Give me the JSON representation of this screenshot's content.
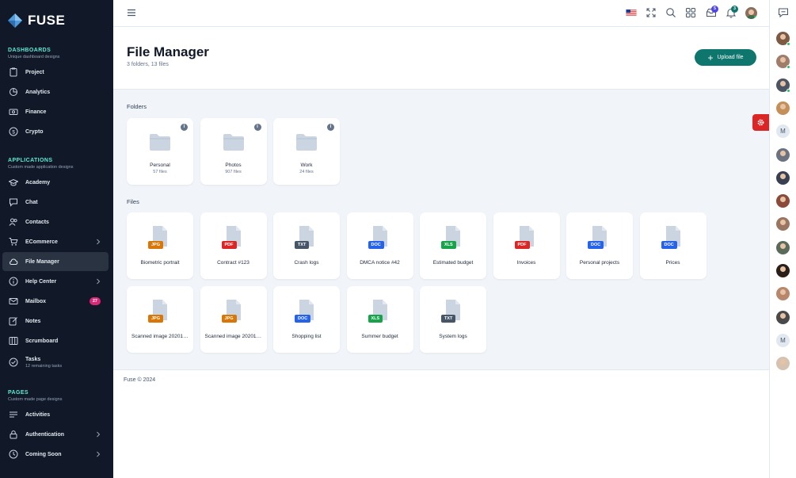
{
  "brand": {
    "name": "FUSE"
  },
  "sidebar": {
    "groups": [
      {
        "title": "DASHBOARDS",
        "subtitle": "Unique dashboard designs",
        "items": [
          {
            "label": "Project"
          },
          {
            "label": "Analytics"
          },
          {
            "label": "Finance"
          },
          {
            "label": "Crypto"
          }
        ]
      },
      {
        "title": "APPLICATIONS",
        "subtitle": "Custom made application designs",
        "items": [
          {
            "label": "Academy"
          },
          {
            "label": "Chat"
          },
          {
            "label": "Contacts"
          },
          {
            "label": "ECommerce"
          },
          {
            "label": "File Manager"
          },
          {
            "label": "Help Center"
          },
          {
            "label": "Mailbox",
            "badge": "27"
          },
          {
            "label": "Notes"
          },
          {
            "label": "Scrumboard"
          },
          {
            "label": "Tasks",
            "sub": "12 remaining tasks"
          }
        ]
      },
      {
        "title": "PAGES",
        "subtitle": "Custom made page designs",
        "items": [
          {
            "label": "Activities"
          },
          {
            "label": "Authentication"
          },
          {
            "label": "Coming Soon"
          }
        ]
      }
    ]
  },
  "topbar": {
    "messages_badge": "5",
    "notifications_badge": "3"
  },
  "header": {
    "title": "File Manager",
    "meta": "3 folders, 13 files",
    "upload_label": "Upload file"
  },
  "sections": {
    "folders": "Folders",
    "files": "Files"
  },
  "folders": [
    {
      "name": "Personal",
      "count": "57 files"
    },
    {
      "name": "Photos",
      "count": "907 files"
    },
    {
      "name": "Work",
      "count": "24 files"
    }
  ],
  "files": [
    {
      "name": "Biometric portrait",
      "type": "JPG"
    },
    {
      "name": "Contract #123",
      "type": "PDF"
    },
    {
      "name": "Crash logs",
      "type": "TXT"
    },
    {
      "name": "DMCA notice #42",
      "type": "DOC"
    },
    {
      "name": "Estimated budget",
      "type": "XLS"
    },
    {
      "name": "Invoices",
      "type": "PDF"
    },
    {
      "name": "Personal projects",
      "type": "DOC"
    },
    {
      "name": "Prices",
      "type": "DOC"
    },
    {
      "name": "Scanned image 20201012-1",
      "type": "JPG"
    },
    {
      "name": "Scanned image 20201012-2",
      "type": "JPG"
    },
    {
      "name": "Shopping list",
      "type": "DOC"
    },
    {
      "name": "Summer budget",
      "type": "XLS"
    },
    {
      "name": "System logs",
      "type": "TXT"
    }
  ],
  "type_colors": {
    "JPG": "#d97706",
    "PDF": "#dc2626",
    "TXT": "#475569",
    "DOC": "#2563eb",
    "XLS": "#16a34a"
  },
  "footer": {
    "text": "Fuse © 2024"
  },
  "contacts": [
    "M",
    "M"
  ]
}
